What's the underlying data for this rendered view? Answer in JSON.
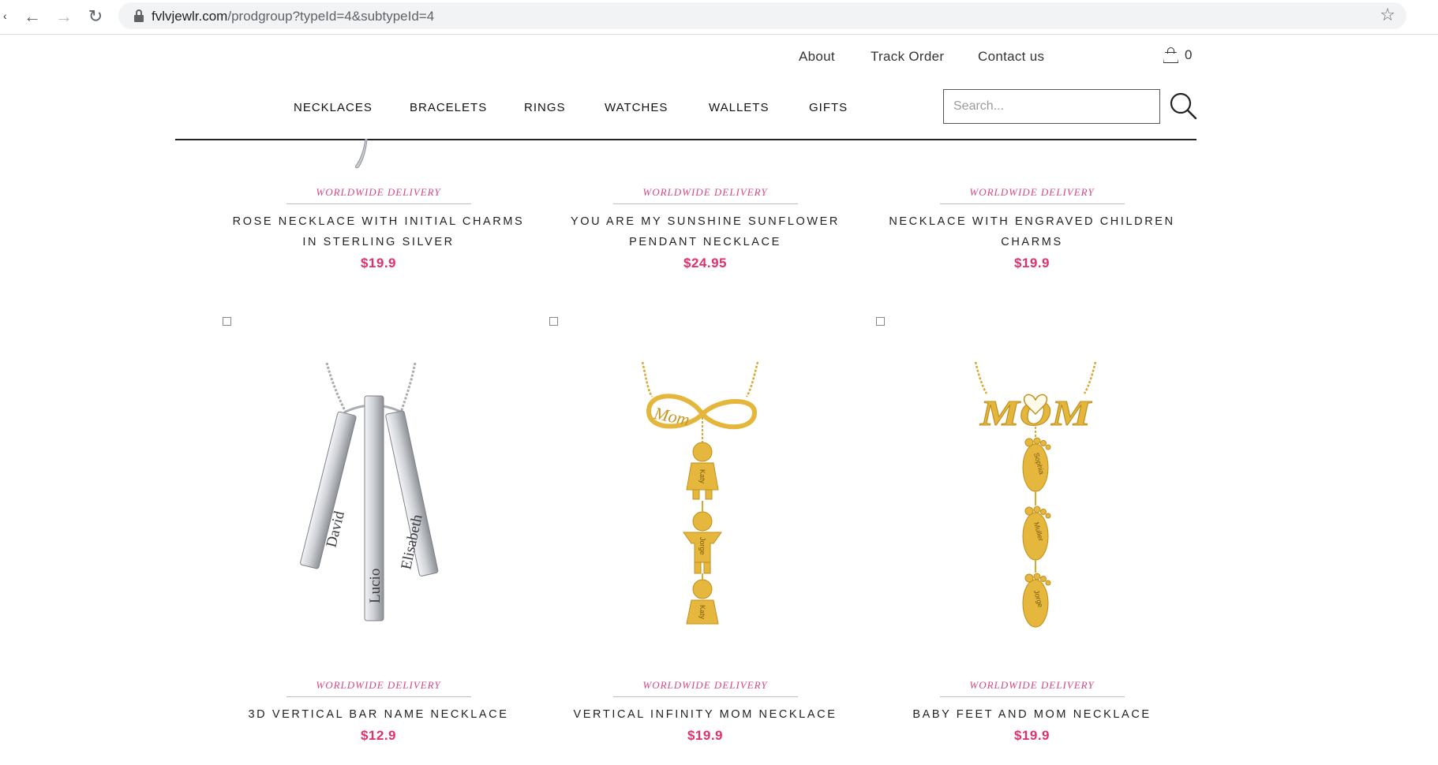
{
  "browser": {
    "url_host": "fvlvjewlr.com",
    "url_path": "/prodgroup?typeId=4&subtypeId=4"
  },
  "header": {
    "top_links": [
      "About",
      "Track Order",
      "Contact us"
    ],
    "cart_count": "0",
    "nav": [
      "NECKLACES",
      "BRACELETS",
      "RINGS",
      "WATCHES",
      "WALLETS",
      "GIFTS"
    ],
    "search_placeholder": "Search..."
  },
  "products": [
    {
      "delivery": "WORLDWIDE DELIVERY",
      "name": "ROSE NECKLACE WITH INITIAL CHARMS IN STERLING SILVER",
      "price": "$19.9"
    },
    {
      "delivery": "WORLDWIDE DELIVERY",
      "name": "YOU ARE MY SUNSHINE SUNFLOWER PENDANT NECKLACE",
      "price": "$24.95"
    },
    {
      "delivery": "WORLDWIDE DELIVERY",
      "name": "NECKLACE WITH ENGRAVED CHILDREN CHARMS",
      "price": "$19.9"
    },
    {
      "delivery": "WORLDWIDE DELIVERY",
      "name": "3D VERTICAL BAR NAME NECKLACE",
      "price": "$12.9",
      "engravings": [
        "David",
        "Lucio",
        "Elisabeth"
      ]
    },
    {
      "delivery": "WORLDWIDE DELIVERY",
      "name": "VERTICAL INFINITY MOM NECKLACE",
      "price": "$19.9",
      "engravings": [
        "Mom",
        "Katy",
        "Jorge",
        "Katy"
      ]
    },
    {
      "delivery": "WORLDWIDE DELIVERY",
      "name": "BABY FEET AND MOM NECKLACE",
      "price": "$19.9",
      "engravings": [
        "MOM",
        "Sophia",
        "Muller",
        "Jorge"
      ]
    }
  ],
  "colors": {
    "accent_pink": "#e0306e",
    "delivery_pink": "#d54a84",
    "gold": "#e4b73c",
    "silver": "#c9ccd0"
  }
}
